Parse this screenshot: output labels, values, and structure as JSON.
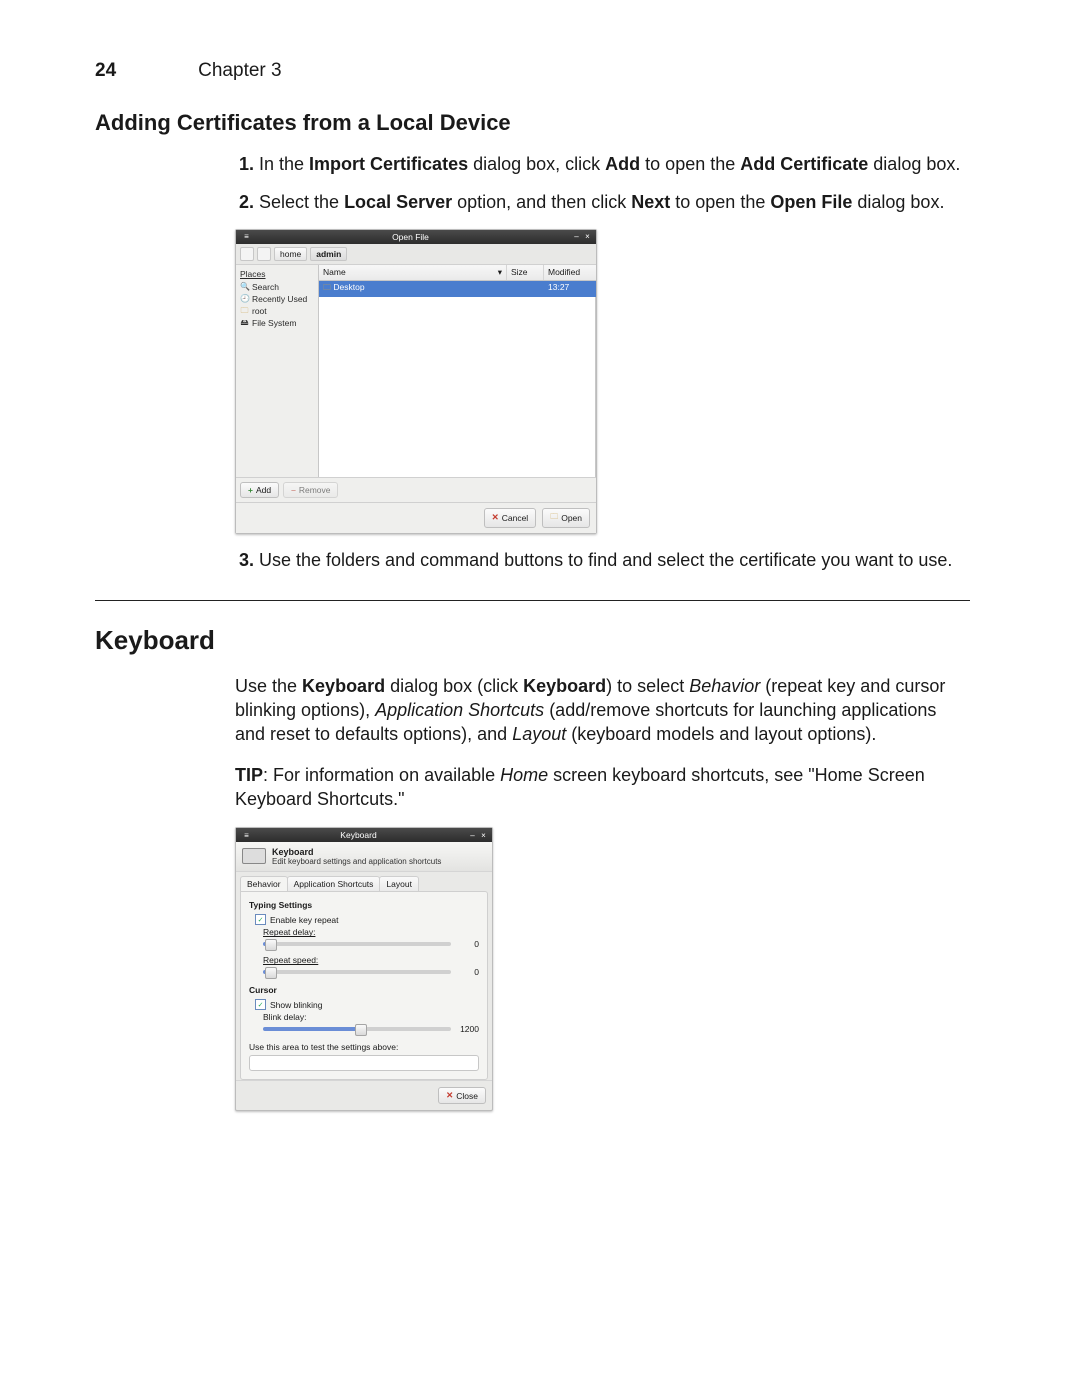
{
  "page": {
    "number": "24",
    "chapter": "Chapter 3"
  },
  "section1": {
    "title": "Adding Certificates from a Local Device",
    "steps": [
      "In the <b>Import Certificates</b> dialog box, click <b>Add</b> to open the <b>Add Certificate</b> dialog box.",
      "Select the <b>Local Server</b> option, and then click <b>Next</b> to open the <b>Open File</b> dialog box.",
      "Use the folders and command buttons to find and select the certificate you want to use."
    ]
  },
  "openfile": {
    "title": "Open File",
    "breadcrumb": [
      "home",
      "admin"
    ],
    "places_header": "Places",
    "places": [
      "Search",
      "Recently Used",
      "root",
      "File System"
    ],
    "cols": {
      "name": "Name",
      "size": "Size",
      "modified": "Modified"
    },
    "row": {
      "name": "Desktop",
      "modified": "13:27"
    },
    "add": "Add",
    "remove": "Remove",
    "cancel": "Cancel",
    "open": "Open"
  },
  "section2": {
    "title": "Keyboard",
    "para1_prefix": "Use the ",
    "para1_bold1": "Keyboard",
    "para1_mid1": " dialog box (click ",
    "para1_bold2": "Keyboard",
    "para1_mid2": ") to select ",
    "para1_it1": "Behavior",
    "para1_mid3": " (repeat key and cursor blinking options), ",
    "para1_it2": "Application Shortcuts",
    "para1_mid4": " (add/remove shortcuts for launching applications and reset to defaults options), and ",
    "para1_it3": "Layout",
    "para1_mid5": " (keyboard models and layout options).",
    "tip_bold": "TIP",
    "tip_mid1": ": For information on available ",
    "tip_it": "Home",
    "tip_mid2": " screen keyboard shortcuts, see \"Home Screen Keyboard Shortcuts.\""
  },
  "keyboard": {
    "title": "Keyboard",
    "head_t1": "Keyboard",
    "head_t2": "Edit keyboard settings and application shortcuts",
    "tabs": [
      "Behavior",
      "Application Shortcuts",
      "Layout"
    ],
    "group1": "Typing Settings",
    "ck1": "Enable key repeat",
    "lbl_delay": "Repeat delay:",
    "lbl_speed": "Repeat speed:",
    "val_delay": "0",
    "val_speed": "0",
    "group2": "Cursor",
    "ck2": "Show blinking",
    "lbl_blink": "Blink delay:",
    "val_blink": "1200",
    "test_label": "Use this area to test the settings above:",
    "close": "Close"
  }
}
